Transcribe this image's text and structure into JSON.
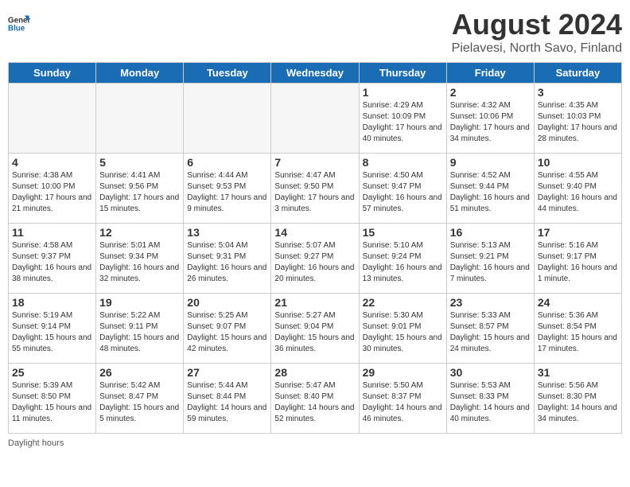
{
  "header": {
    "title": "August 2024",
    "subtitle": "Pielavesi, North Savo, Finland",
    "logo_line1": "General",
    "logo_line2": "Blue"
  },
  "days_of_week": [
    "Sunday",
    "Monday",
    "Tuesday",
    "Wednesday",
    "Thursday",
    "Friday",
    "Saturday"
  ],
  "weeks": [
    [
      {
        "day": "",
        "info": ""
      },
      {
        "day": "",
        "info": ""
      },
      {
        "day": "",
        "info": ""
      },
      {
        "day": "",
        "info": ""
      },
      {
        "day": "1",
        "info": "Sunrise: 4:29 AM\nSunset: 10:09 PM\nDaylight: 17 hours and 40 minutes."
      },
      {
        "day": "2",
        "info": "Sunrise: 4:32 AM\nSunset: 10:06 PM\nDaylight: 17 hours and 34 minutes."
      },
      {
        "day": "3",
        "info": "Sunrise: 4:35 AM\nSunset: 10:03 PM\nDaylight: 17 hours and 28 minutes."
      }
    ],
    [
      {
        "day": "4",
        "info": "Sunrise: 4:38 AM\nSunset: 10:00 PM\nDaylight: 17 hours and 21 minutes."
      },
      {
        "day": "5",
        "info": "Sunrise: 4:41 AM\nSunset: 9:56 PM\nDaylight: 17 hours and 15 minutes."
      },
      {
        "day": "6",
        "info": "Sunrise: 4:44 AM\nSunset: 9:53 PM\nDaylight: 17 hours and 9 minutes."
      },
      {
        "day": "7",
        "info": "Sunrise: 4:47 AM\nSunset: 9:50 PM\nDaylight: 17 hours and 3 minutes."
      },
      {
        "day": "8",
        "info": "Sunrise: 4:50 AM\nSunset: 9:47 PM\nDaylight: 16 hours and 57 minutes."
      },
      {
        "day": "9",
        "info": "Sunrise: 4:52 AM\nSunset: 9:44 PM\nDaylight: 16 hours and 51 minutes."
      },
      {
        "day": "10",
        "info": "Sunrise: 4:55 AM\nSunset: 9:40 PM\nDaylight: 16 hours and 44 minutes."
      }
    ],
    [
      {
        "day": "11",
        "info": "Sunrise: 4:58 AM\nSunset: 9:37 PM\nDaylight: 16 hours and 38 minutes."
      },
      {
        "day": "12",
        "info": "Sunrise: 5:01 AM\nSunset: 9:34 PM\nDaylight: 16 hours and 32 minutes."
      },
      {
        "day": "13",
        "info": "Sunrise: 5:04 AM\nSunset: 9:31 PM\nDaylight: 16 hours and 26 minutes."
      },
      {
        "day": "14",
        "info": "Sunrise: 5:07 AM\nSunset: 9:27 PM\nDaylight: 16 hours and 20 minutes."
      },
      {
        "day": "15",
        "info": "Sunrise: 5:10 AM\nSunset: 9:24 PM\nDaylight: 16 hours and 13 minutes."
      },
      {
        "day": "16",
        "info": "Sunrise: 5:13 AM\nSunset: 9:21 PM\nDaylight: 16 hours and 7 minutes."
      },
      {
        "day": "17",
        "info": "Sunrise: 5:16 AM\nSunset: 9:17 PM\nDaylight: 16 hours and 1 minute."
      }
    ],
    [
      {
        "day": "18",
        "info": "Sunrise: 5:19 AM\nSunset: 9:14 PM\nDaylight: 15 hours and 55 minutes."
      },
      {
        "day": "19",
        "info": "Sunrise: 5:22 AM\nSunset: 9:11 PM\nDaylight: 15 hours and 48 minutes."
      },
      {
        "day": "20",
        "info": "Sunrise: 5:25 AM\nSunset: 9:07 PM\nDaylight: 15 hours and 42 minutes."
      },
      {
        "day": "21",
        "info": "Sunrise: 5:27 AM\nSunset: 9:04 PM\nDaylight: 15 hours and 36 minutes."
      },
      {
        "day": "22",
        "info": "Sunrise: 5:30 AM\nSunset: 9:01 PM\nDaylight: 15 hours and 30 minutes."
      },
      {
        "day": "23",
        "info": "Sunrise: 5:33 AM\nSunset: 8:57 PM\nDaylight: 15 hours and 24 minutes."
      },
      {
        "day": "24",
        "info": "Sunrise: 5:36 AM\nSunset: 8:54 PM\nDaylight: 15 hours and 17 minutes."
      }
    ],
    [
      {
        "day": "25",
        "info": "Sunrise: 5:39 AM\nSunset: 8:50 PM\nDaylight: 15 hours and 11 minutes."
      },
      {
        "day": "26",
        "info": "Sunrise: 5:42 AM\nSunset: 8:47 PM\nDaylight: 15 hours and 5 minutes."
      },
      {
        "day": "27",
        "info": "Sunrise: 5:44 AM\nSunset: 8:44 PM\nDaylight: 14 hours and 59 minutes."
      },
      {
        "day": "28",
        "info": "Sunrise: 5:47 AM\nSunset: 8:40 PM\nDaylight: 14 hours and 52 minutes."
      },
      {
        "day": "29",
        "info": "Sunrise: 5:50 AM\nSunset: 8:37 PM\nDaylight: 14 hours and 46 minutes."
      },
      {
        "day": "30",
        "info": "Sunrise: 5:53 AM\nSunset: 8:33 PM\nDaylight: 14 hours and 40 minutes."
      },
      {
        "day": "31",
        "info": "Sunrise: 5:56 AM\nSunset: 8:30 PM\nDaylight: 14 hours and 34 minutes."
      }
    ]
  ],
  "footer": {
    "note": "Daylight hours"
  }
}
